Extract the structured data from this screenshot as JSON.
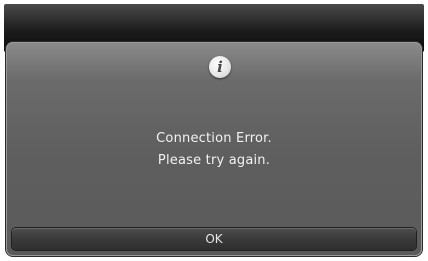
{
  "dialog": {
    "icon": "info-icon",
    "icon_glyph": "i",
    "message_line1": "Connection Error.",
    "message_line2": "Please try again.",
    "ok_label": "OK"
  },
  "colors": {
    "dialog_background": "#5f5f5f",
    "button_background": "#3a3a3a",
    "text": "#f2f2f2"
  }
}
